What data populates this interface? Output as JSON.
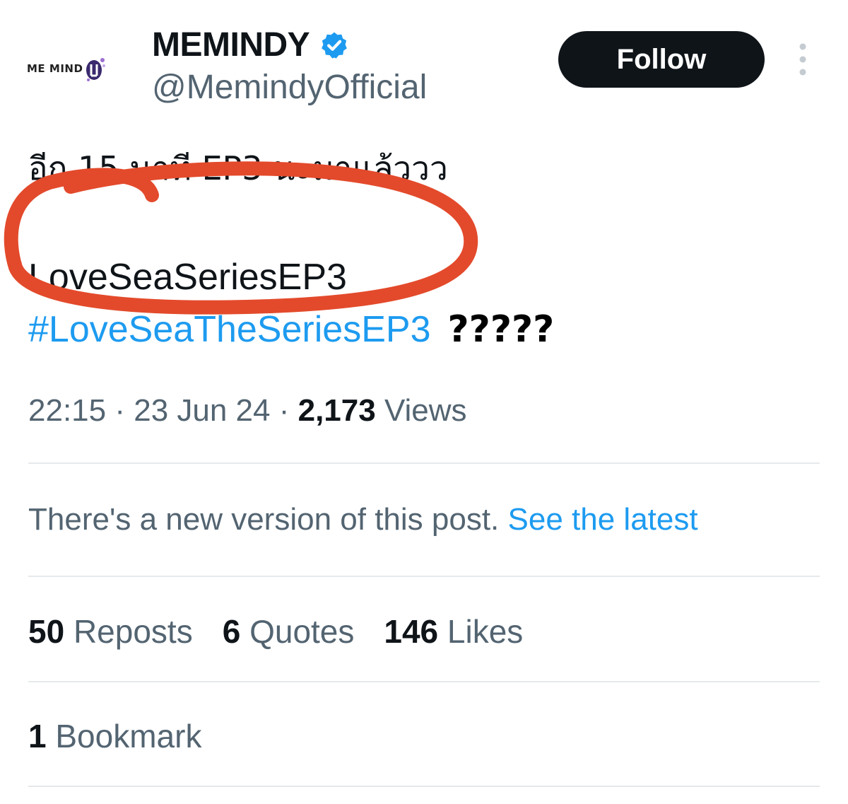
{
  "header": {
    "avatar_text": "ME MIND",
    "display_name": "MEMINDY",
    "handle": "@MemindyOfficial",
    "follow_label": "Follow"
  },
  "post": {
    "line1": "อีก 15 นาที EP3 นะมาแล้ววว",
    "line2": "LoveSeaSeriesEP3",
    "hashtag": "#LoveSeaTheSeriesEP3",
    "annotation": "?????"
  },
  "meta": {
    "time": "22:15",
    "separator": " · ",
    "date": "23 Jun 24",
    "views_count": "2,173",
    "views_label": "Views"
  },
  "notice": {
    "text": "There's a new version of this post.",
    "link": "See the latest"
  },
  "stats": {
    "reposts_count": "50",
    "reposts_label": "Reposts",
    "quotes_count": "6",
    "quotes_label": "Quotes",
    "likes_count": "146",
    "likes_label": "Likes"
  },
  "bookmarks": {
    "count": "1",
    "label": "Bookmark"
  },
  "colors": {
    "link": "#1d9bf0",
    "secondary_text": "#536471",
    "primary_text": "#0f1419",
    "follow_bg": "#0f1419",
    "verified": "#1d9bf0",
    "annotation_red": "#e34a2b",
    "divider": "#e6e9eb"
  }
}
